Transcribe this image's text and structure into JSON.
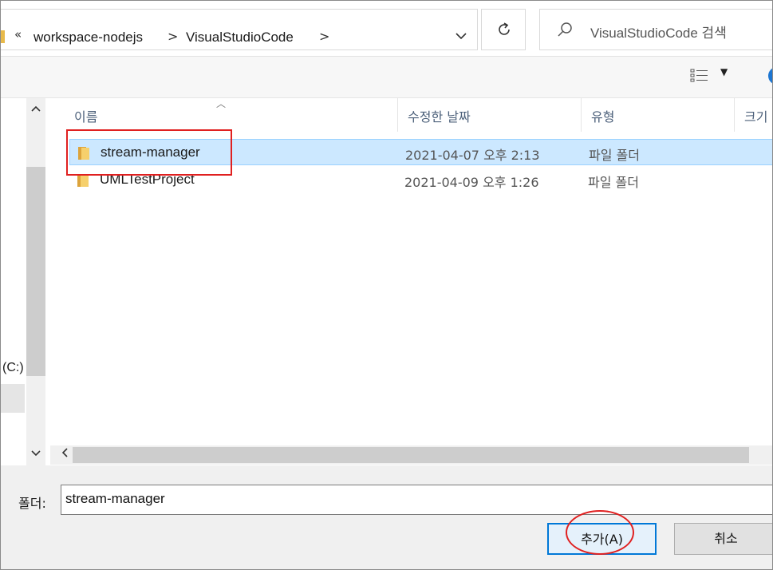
{
  "address_bar": {
    "overflow_chevron": "«",
    "breadcrumbs": [
      "workspace-nodejs",
      "VisualStudioCode"
    ],
    "separator": ">",
    "dropdown_icon": "chevron-down-icon",
    "refresh_icon": "refresh-icon"
  },
  "search": {
    "placeholder": "VisualStudioCode 검색",
    "icon": "search-icon"
  },
  "toolbar": {
    "view_icon": "details-view-icon",
    "help_icon": "help-icon"
  },
  "nav_pane": {
    "drive_label": "(C:)"
  },
  "columns": [
    {
      "label": "이름"
    },
    {
      "label": "수정한 날짜"
    },
    {
      "label": "유형"
    },
    {
      "label": "크기"
    }
  ],
  "files": [
    {
      "name": "stream-manager",
      "modified": "2021-04-07 오후 2:13",
      "type": "파일 폴더",
      "selected": true
    },
    {
      "name": "UMLTestProject",
      "modified": "2021-04-09 오후 1:26",
      "type": "파일 폴더",
      "selected": false
    }
  ],
  "folder_field": {
    "label": "폴더:",
    "value": "stream-manager"
  },
  "buttons": {
    "add": "추가(A)",
    "cancel": "취소"
  },
  "colors": {
    "selection_fill": "#cce8ff",
    "selection_border": "#99d1ff",
    "annotation": "#e02020",
    "primary_border": "#0078d7"
  }
}
